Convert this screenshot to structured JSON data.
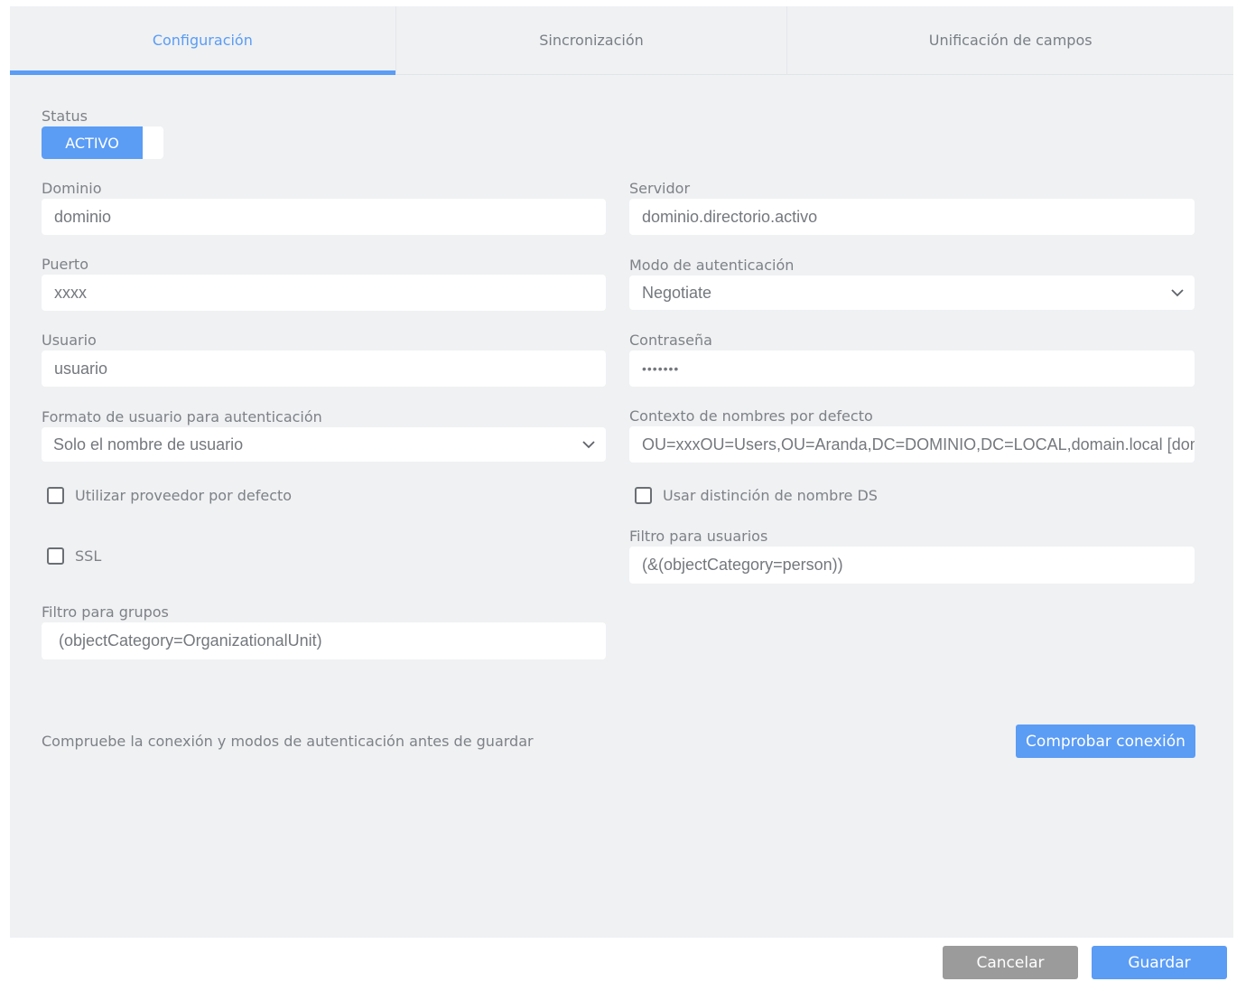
{
  "tabs": [
    {
      "label": "Configuración",
      "active": true
    },
    {
      "label": "Sincronización",
      "active": false
    },
    {
      "label": "Unificación de campos",
      "active": false
    }
  ],
  "status": {
    "label": "Status",
    "value": "ACTIVO"
  },
  "fields": {
    "dominio": {
      "label": "Dominio",
      "value": "dominio"
    },
    "servidor": {
      "label": "Servidor",
      "value": "dominio.directorio.activo"
    },
    "puerto": {
      "label": "Puerto",
      "value": "xxxx"
    },
    "modo_autenticacion": {
      "label": "Modo de autenticación",
      "value": "Negotiate"
    },
    "usuario": {
      "label": "Usuario",
      "value": "usuario"
    },
    "contrasena": {
      "label": "Contraseña",
      "value": "•••••••"
    },
    "formato_usuario": {
      "label": "Formato de usuario para autenticación",
      "value": "Solo el nombre de usuario"
    },
    "contexto_nombres": {
      "label": "Contexto de nombres por defecto",
      "value": "OU=xxxOU=Users,OU=Aranda,DC=DOMINIO,DC=LOCAL,domain.local [domain.local]"
    },
    "filtro_usuarios": {
      "label": "Filtro para usuarios",
      "value": "(&(objectCategory=person))"
    },
    "filtro_grupos": {
      "label": "Filtro para grupos",
      "value": "(objectCategory=OrganizationalUnit)"
    }
  },
  "checkboxes": {
    "proveedor_defecto": {
      "label": "Utilizar proveedor por defecto",
      "checked": false
    },
    "ssl": {
      "label": "SSL",
      "checked": false
    },
    "distincion_ds": {
      "label": "Usar distinción de nombre DS",
      "checked": false
    }
  },
  "hint": "Compruebe la conexión y modos de autenticación antes de guardar",
  "buttons": {
    "check_connection": "Comprobar conexión",
    "cancel": "Cancelar",
    "save": "Guardar"
  },
  "colors": {
    "accent": "#5b9cf5",
    "cancel": "#9b9b9b",
    "panel_bg": "#eff1f3"
  }
}
